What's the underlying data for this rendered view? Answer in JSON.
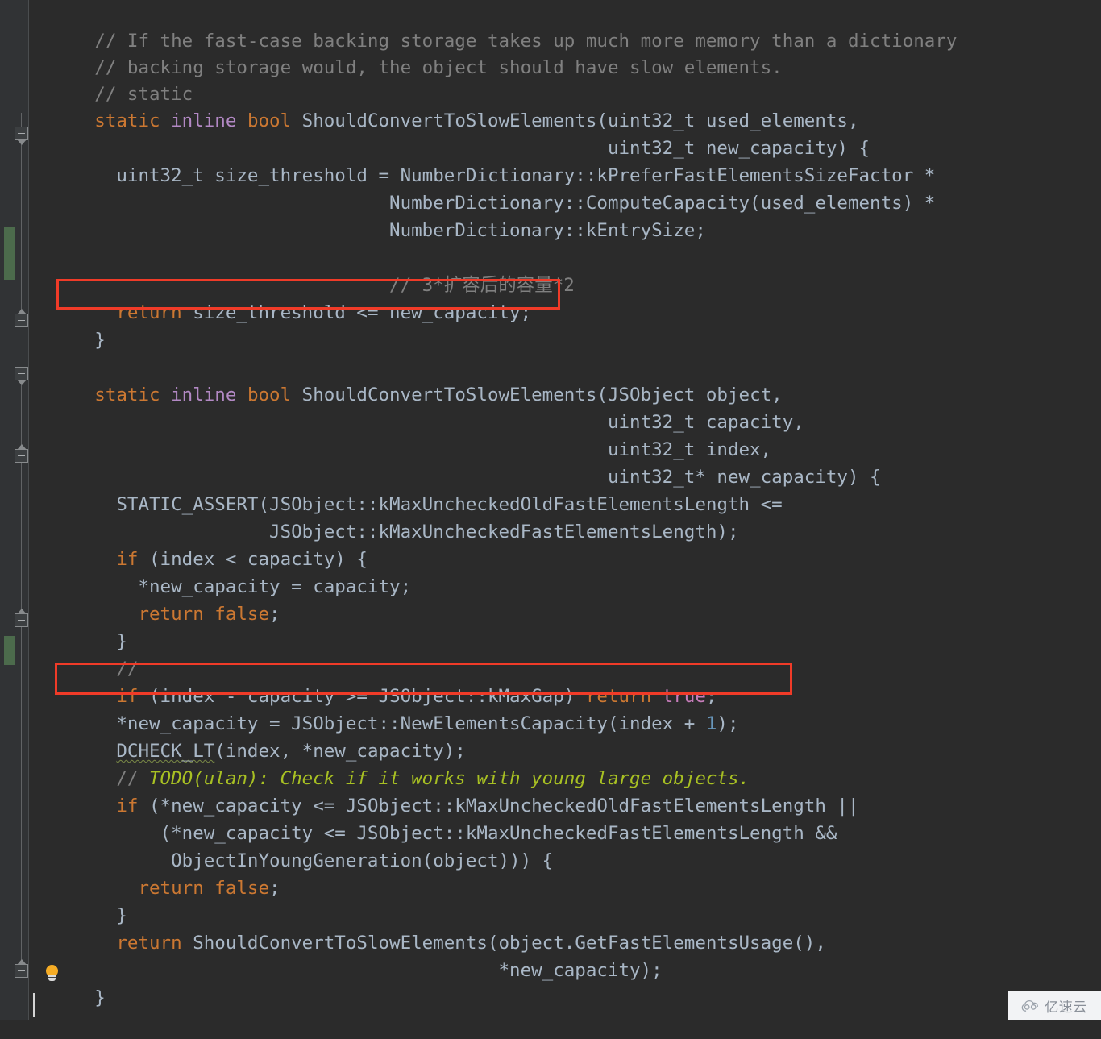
{
  "editor": {
    "theme": "darcula",
    "background": "#2b2b2b",
    "gutter_background": "#313335",
    "default_text_color": "#a9b7c6",
    "keyword_color": "#cc7832",
    "comment_color": "#808080",
    "todo_color": "#a8c023",
    "number_color": "#6897bb",
    "annotation_box_color": "#f03b28",
    "change_marker_color": "#4c6b4c",
    "language": "C++"
  },
  "code_lines": [
    {
      "id": "l1",
      "indent": "",
      "text": "// If the fast-case backing storage takes up much more memory than a dictionary",
      "kind": "comment"
    },
    {
      "id": "l2",
      "indent": "",
      "text": "// backing storage would, the object should have slow elements.",
      "kind": "comment"
    },
    {
      "id": "l3",
      "indent": "",
      "text": "// static",
      "kind": "comment"
    },
    {
      "id": "l4",
      "indent": "",
      "text": "static inline bool ShouldConvertToSlowElements(uint32_t used_elements,",
      "kind": "code"
    },
    {
      "id": "l5",
      "indent": "",
      "text": "                                               uint32_t new_capacity) {",
      "kind": "code"
    },
    {
      "id": "l6",
      "indent": "",
      "text": "  uint32_t size_threshold = NumberDictionary::kPreferFastElementsSizeFactor *",
      "kind": "code"
    },
    {
      "id": "l7",
      "indent": "",
      "text": "                           NumberDictionary::ComputeCapacity(used_elements) *",
      "kind": "code"
    },
    {
      "id": "l8",
      "indent": "",
      "text": "                           NumberDictionary::kEntrySize;",
      "kind": "code"
    },
    {
      "id": "l9",
      "indent": "",
      "text": "",
      "kind": "blank"
    },
    {
      "id": "l10",
      "indent": "",
      "text": "                           // 3*扩容后的容量*2",
      "kind": "comment"
    },
    {
      "id": "l11",
      "indent": "",
      "text": "  return size_threshold <= new_capacity;",
      "kind": "code",
      "highlighted": true
    },
    {
      "id": "l12",
      "indent": "",
      "text": "}",
      "kind": "code"
    },
    {
      "id": "l13",
      "indent": "",
      "text": "",
      "kind": "blank"
    },
    {
      "id": "l14",
      "indent": "",
      "text": "static inline bool ShouldConvertToSlowElements(JSObject object,",
      "kind": "code"
    },
    {
      "id": "l15",
      "indent": "",
      "text": "                                               uint32_t capacity,",
      "kind": "code"
    },
    {
      "id": "l16",
      "indent": "",
      "text": "                                               uint32_t index,",
      "kind": "code"
    },
    {
      "id": "l17",
      "indent": "",
      "text": "                                               uint32_t* new_capacity) {",
      "kind": "code"
    },
    {
      "id": "l18",
      "indent": "",
      "text": "  STATIC_ASSERT(JSObject::kMaxUncheckedOldFastElementsLength <=",
      "kind": "code"
    },
    {
      "id": "l19",
      "indent": "",
      "text": "                JSObject::kMaxUncheckedFastElementsLength);",
      "kind": "code"
    },
    {
      "id": "l20",
      "indent": "",
      "text": "  if (index < capacity) {",
      "kind": "code"
    },
    {
      "id": "l21",
      "indent": "",
      "text": "    *new_capacity = capacity;",
      "kind": "code"
    },
    {
      "id": "l22",
      "indent": "",
      "text": "    return false;",
      "kind": "code"
    },
    {
      "id": "l23",
      "indent": "",
      "text": "  }",
      "kind": "code"
    },
    {
      "id": "l24",
      "indent": "",
      "text": "  //",
      "kind": "comment"
    },
    {
      "id": "l25",
      "indent": "",
      "text": "  if (index - capacity >= JSObject::kMaxGap) return true;",
      "kind": "code",
      "highlighted": true
    },
    {
      "id": "l26",
      "indent": "",
      "text": "  *new_capacity = JSObject::NewElementsCapacity(index + 1);",
      "kind": "code"
    },
    {
      "id": "l27",
      "indent": "",
      "text": "  DCHECK_LT(index, *new_capacity);",
      "kind": "code",
      "has_warning_squiggle": true
    },
    {
      "id": "l28",
      "indent": "",
      "text": "  // TODO(ulan): Check if it works with young large objects.",
      "kind": "todo"
    },
    {
      "id": "l29",
      "indent": "",
      "text": "  if (*new_capacity <= JSObject::kMaxUncheckedOldFastElementsLength ||",
      "kind": "code"
    },
    {
      "id": "l30",
      "indent": "",
      "text": "      (*new_capacity <= JSObject::kMaxUncheckedFastElementsLength &&",
      "kind": "code"
    },
    {
      "id": "l31",
      "indent": "",
      "text": "       ObjectInYoungGeneration(object))) {",
      "kind": "code"
    },
    {
      "id": "l32",
      "indent": "",
      "text": "    return false;",
      "kind": "code"
    },
    {
      "id": "l33",
      "indent": "",
      "text": "  }",
      "kind": "code"
    },
    {
      "id": "l34",
      "indent": "",
      "text": "  return ShouldConvertToSlowElements(object.GetFastElementsUsage(),",
      "kind": "code"
    },
    {
      "id": "l35",
      "indent": "",
      "text": "                                     *new_capacity);",
      "kind": "code"
    },
    {
      "id": "l36",
      "indent": "",
      "text": "}",
      "kind": "code"
    }
  ],
  "annotations": [
    {
      "id": "box1",
      "target_line": "l11",
      "label": "return size_threshold <= new_capacity;"
    },
    {
      "id": "box2",
      "target_line": "l25",
      "label": "if (index - capacity >= JSObject::kMaxGap) return true;"
    }
  ],
  "gutter": {
    "fold_markers": [
      {
        "id": "fold-1",
        "state": "expanded",
        "direction": "down"
      },
      {
        "id": "fold-2",
        "state": "expanded",
        "direction": "up"
      },
      {
        "id": "fold-3",
        "state": "expanded",
        "direction": "down"
      },
      {
        "id": "fold-4",
        "state": "expanded",
        "direction": "down"
      },
      {
        "id": "fold-5",
        "state": "expanded",
        "direction": "up"
      },
      {
        "id": "fold-6",
        "state": "expanded",
        "direction": "up"
      }
    ],
    "change_markers": [
      {
        "id": "change-1",
        "type": "modified"
      },
      {
        "id": "change-2",
        "type": "modified"
      }
    ],
    "intention_bulb": {
      "id": "intention-bulb",
      "tooltip": "Show Context Actions"
    }
  },
  "watermark": {
    "text": "亿速云",
    "icon": "cloud-icon"
  }
}
